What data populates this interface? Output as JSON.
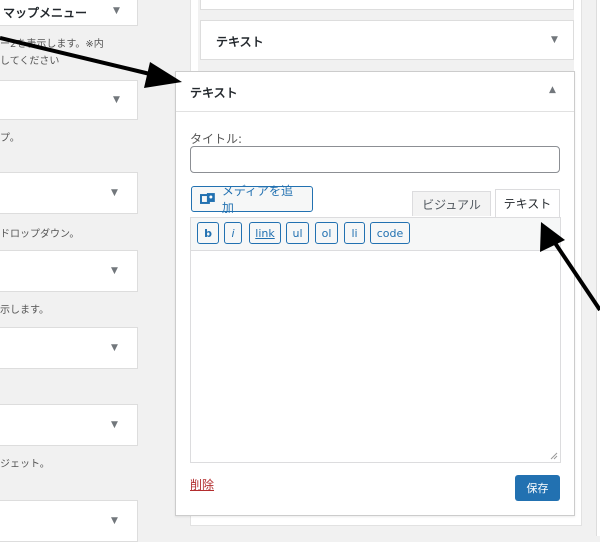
{
  "left_column": {
    "items": [
      {
        "title": "マップメニュー",
        "note_lines": [
          "ー2を表示します。※内",
          "してください"
        ]
      },
      {
        "title": "",
        "note_lines": [
          "プ。"
        ]
      },
      {
        "title": "",
        "note_lines": [
          "ドロップダウン。"
        ]
      },
      {
        "title": "",
        "note_lines": [
          "示します。"
        ]
      },
      {
        "title": "",
        "note_lines": []
      },
      {
        "title": "",
        "note_lines": [
          "ジェット。"
        ]
      },
      {
        "title": "",
        "note_lines": []
      }
    ]
  },
  "sidebar": {
    "collapsed_widget": {
      "title": "テキスト"
    }
  },
  "text_widget": {
    "header_title": "テキスト",
    "title_label": "タイトル:",
    "title_value": "",
    "add_media_label": "メディアを追加",
    "tabs": {
      "visual": "ビジュアル",
      "text": "テキスト"
    },
    "quicktags": [
      "b",
      "i",
      "link",
      "ul",
      "ol",
      "li",
      "code"
    ],
    "content": "",
    "delete_label": "削除",
    "save_label": "保存"
  },
  "colors": {
    "primary": "#2271b1",
    "delete": "#b32d2e",
    "arrow": "#000000",
    "background": "#f1f1f1"
  }
}
